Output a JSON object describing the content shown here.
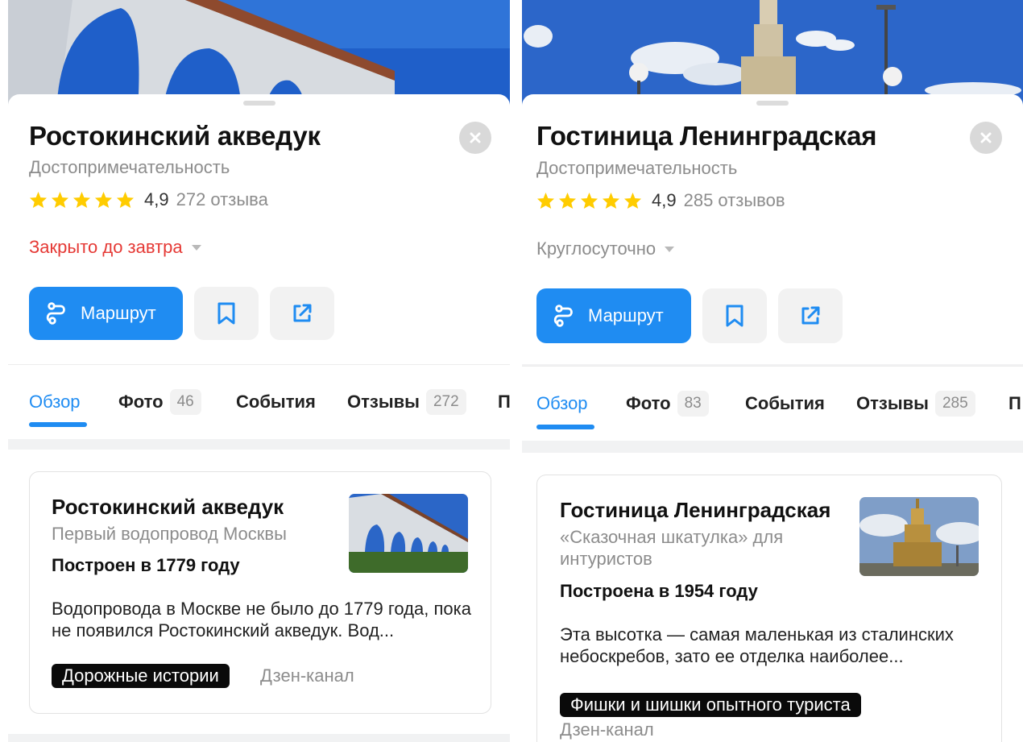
{
  "colors": {
    "accent": "#1f8cf2",
    "closed_red": "#e53935",
    "star_yellow": "#ffcc00"
  },
  "left": {
    "title": "Ростокинский акведук",
    "category": "Достопримечательность",
    "rating": "4,9",
    "reviews": "272 отзыва",
    "stars": 5,
    "hours": "Закрыто до завтра",
    "route_label": "Маршрут",
    "tabs": [
      {
        "label": "Обзор"
      },
      {
        "label": "Фото",
        "count": "46"
      },
      {
        "label": "События"
      },
      {
        "label": "Отзывы",
        "count": "272"
      },
      {
        "label": "П"
      }
    ],
    "card": {
      "title": "Ростокинский акведук",
      "subtitle": "Первый водопровод Москвы",
      "built": "Построен в 1779 году",
      "text": "Водопровода в Москве не было до 1779 года, пока не появился Ростокинский акведук. Вод...",
      "badge": "Дорожные истории",
      "source": "Дзен-канал"
    }
  },
  "right": {
    "title": "Гостиница Ленинградская",
    "category": "Достопримечательность",
    "rating": "4,9",
    "reviews": "285 отзывов",
    "stars": 5,
    "hours": "Круглосуточно",
    "route_label": "Маршрут",
    "tabs": [
      {
        "label": "Обзор"
      },
      {
        "label": "Фото",
        "count": "83"
      },
      {
        "label": "События"
      },
      {
        "label": "Отзывы",
        "count": "285"
      },
      {
        "label": "П"
      }
    ],
    "card": {
      "title": "Гостиница Ленинградская",
      "subtitle": "«Сказочная шкатулка» для интуристов",
      "built": "Построена в 1954 году",
      "text": "Эта высотка — самая маленькая из сталинских небоскребов, зато ее отделка наиболее...",
      "badge": "Фишки и шишки опытного туриста",
      "source": "Дзен-канал"
    }
  }
}
